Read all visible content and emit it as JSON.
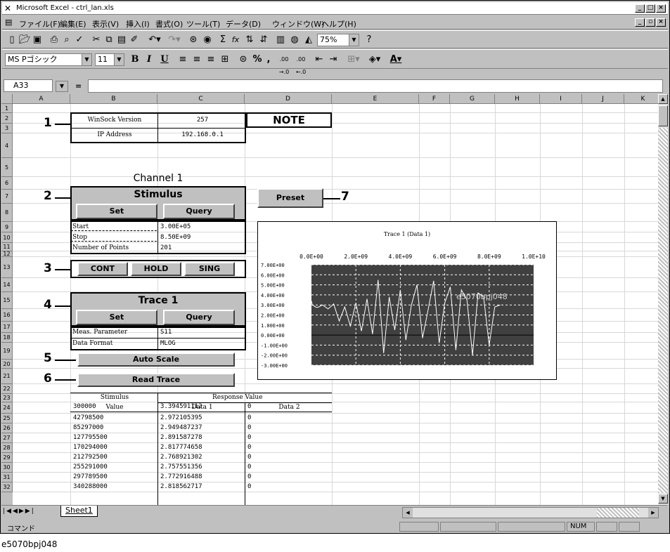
{
  "window": {
    "title": "Microsoft Excel - ctrl_lan.xls",
    "min_icon": "minimize-icon",
    "max_icon": "maximize-icon",
    "close_icon": "close-icon"
  },
  "menu": [
    "ファイル(F)",
    "編集(E)",
    "表示(V)",
    "挿入(I)",
    "書式(O)",
    "ツール(T)",
    "データ(D)",
    "ウィンドウ(W)",
    "ヘルプ(H)"
  ],
  "toolbar": {
    "zoom": "75%",
    "font_name": "MS Pゴシック",
    "font_size": "11",
    "bold": "B",
    "italic": "I",
    "underline": "U",
    "percent": "%",
    "comma": ",",
    "inc_dec": ".00 →.0",
    "dec_dec": ".00 ←.0",
    "sum": "Σ",
    "fx": "fx"
  },
  "formula": {
    "name_box": "A33",
    "eq": "="
  },
  "columns": [
    "A",
    "B",
    "C",
    "D",
    "E",
    "F",
    "G",
    "H",
    "I",
    "J",
    "K"
  ],
  "rows": [
    "1",
    "2",
    "3",
    "4",
    "5",
    "6",
    "7",
    "8",
    "9",
    "10",
    "11",
    "12",
    "13",
    "14",
    "15",
    "16",
    "17",
    "18",
    "19",
    "20",
    "21",
    "22",
    "23",
    "24",
    "25",
    "26",
    "27",
    "28",
    "29",
    "30",
    "31",
    "32"
  ],
  "callouts": [
    "1",
    "2",
    "3",
    "4",
    "5",
    "6",
    "7"
  ],
  "info": {
    "winsock_label": "WinSock Version",
    "winsock_value": "257",
    "ip_label": "IP Address",
    "ip_value": "192.168.0.1",
    "note": "NOTE"
  },
  "channel": {
    "title": "Channel 1",
    "stimulus": "Stimulus",
    "set": "Set",
    "query": "Query",
    "start_label": "Start",
    "start_value": "3.00E+05",
    "stop_label": "Stop",
    "stop_value": "8.50E+09",
    "points_label": "Number of Points",
    "points_value": "201",
    "preset": "Preset"
  },
  "trigger": {
    "cont": "CONT",
    "hold": "HOLD",
    "sing": "SING"
  },
  "trace": {
    "title": "Trace 1",
    "set": "Set",
    "query": "Query",
    "param_label": "Meas. Parameter",
    "param_value": "S11",
    "format_label": "Data Format",
    "format_value": "MLOG",
    "auto_scale": "Auto Scale",
    "read_trace": "Read Trace"
  },
  "table": {
    "h1_stim": "Stimulus",
    "h1_resp": "Response Value",
    "h2_value": "Value",
    "h2_data1": "Data 1",
    "h2_data2": "Data 2",
    "rows": [
      [
        "300000",
        "3.394591112",
        "0"
      ],
      [
        "42798500",
        "2.972105395",
        "0"
      ],
      [
        "85297000",
        "2.949487237",
        "0"
      ],
      [
        "127795500",
        "2.891587278",
        "0"
      ],
      [
        "170294000",
        "2.817774658",
        "0"
      ],
      [
        "212792500",
        "2.768921302",
        "0"
      ],
      [
        "255291000",
        "2.757551356",
        "0"
      ],
      [
        "297789500",
        "2.772916488",
        "0"
      ],
      [
        "340288000",
        "2.818562717",
        "0"
      ]
    ]
  },
  "chart": {
    "title": "Trace 1 (Data 1)",
    "watermark": "e5070bpj048",
    "x_ticks": [
      "0.0E+00",
      "2.0E+09",
      "4.0E+09",
      "6.0E+09",
      "8.0E+09",
      "1.0E+10"
    ],
    "y_ticks": [
      "7.00E+00",
      "6.00E+00",
      "5.00E+00",
      "4.00E+00",
      "3.00E+00",
      "2.00E+00",
      "1.00E+00",
      "0.00E+00",
      "-1.00E+00",
      "-2.00E+00",
      "-3.00E+00"
    ]
  },
  "chart_data": {
    "type": "line",
    "title": "Trace 1 (Data 1)",
    "xlim": [
      0,
      10000000000
    ],
    "ylim": [
      -3,
      7
    ],
    "series": [
      {
        "x": [
          300000,
          42798500,
          85297000,
          127795500,
          170294000,
          212792500,
          255291000,
          297789500,
          340288000,
          500000000,
          750000000,
          1000000000,
          1250000000,
          1500000000,
          1750000000,
          2000000000,
          2250000000,
          2500000000,
          2750000000,
          3000000000,
          3250000000,
          3500000000,
          3750000000,
          4000000000,
          4250000000,
          4500000000,
          4750000000,
          5000000000,
          5250000000,
          5500000000,
          5750000000,
          6000000000,
          6250000000,
          6500000000,
          6750000000,
          7000000000,
          7250000000,
          7500000000,
          7750000000,
          8000000000,
          8250000000,
          8500000000
        ],
        "y": [
          3.39,
          2.97,
          2.95,
          2.89,
          2.82,
          2.77,
          2.76,
          2.77,
          2.82,
          3.0,
          2.6,
          3.1,
          1.4,
          2.8,
          0.9,
          3.2,
          0.4,
          3.6,
          0.1,
          5.5,
          -1.8,
          3.8,
          0.5,
          4.5,
          -0.5,
          3.0,
          5.0,
          -0.3,
          2.5,
          5.4,
          -0.8,
          3.2,
          4.8,
          -1.5,
          4.5,
          3.5,
          -2.0,
          4.2,
          3.8,
          -1.0,
          2.8,
          3.0
        ]
      }
    ]
  },
  "sheet_tab": "Sheet1",
  "status": {
    "left": "コマンド",
    "num": "NUM"
  },
  "caption": "e5070bpj048"
}
